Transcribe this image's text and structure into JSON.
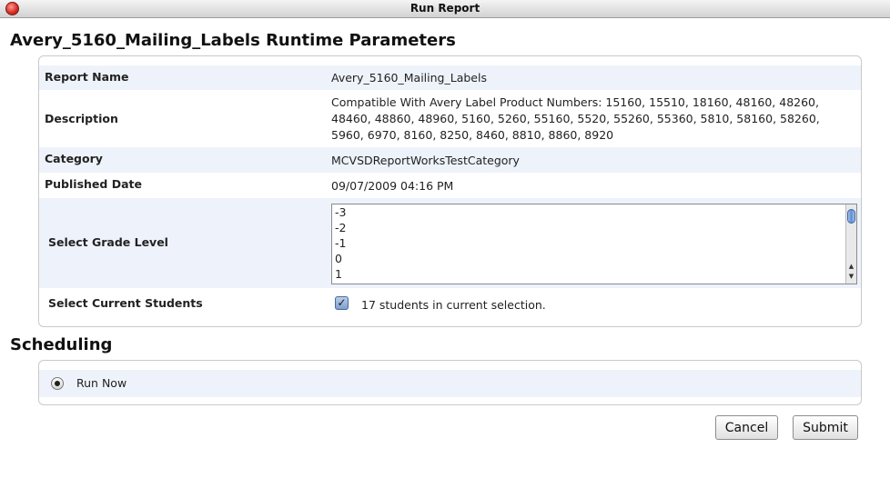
{
  "window": {
    "title": "Run Report"
  },
  "page_title": "Avery_5160_Mailing_Labels Runtime Parameters",
  "params": {
    "report_name_label": "Report Name",
    "report_name_value": "Avery_5160_Mailing_Labels",
    "description_label": "Description",
    "description_value": "Compatible With Avery Label Product Numbers: 15160, 15510, 18160, 48160, 48260, 48460, 48860, 48960, 5160, 5260, 55160, 5520, 55260, 55360, 5810, 58160, 58260, 5960, 6970, 8160, 8250, 8460, 8810, 8860, 8920",
    "category_label": "Category",
    "category_value": "MCVSDReportWorksTestCategory",
    "published_label": "Published Date",
    "published_value": "09/07/2009 04:16 PM",
    "grade_label": "Select Grade Level",
    "grade_options": [
      "-3",
      "-2",
      "-1",
      "0",
      "1"
    ],
    "students_label": "Select Current Students",
    "students_value": "17 students in current selection.",
    "students_checked": true
  },
  "scheduling": {
    "title": "Scheduling",
    "run_now_label": "Run Now",
    "run_now_selected": true
  },
  "actions": {
    "cancel_label": "Cancel",
    "submit_label": "Submit"
  },
  "colors": {
    "row_alt": "#eef3fb",
    "border": "#c9c9c9"
  }
}
